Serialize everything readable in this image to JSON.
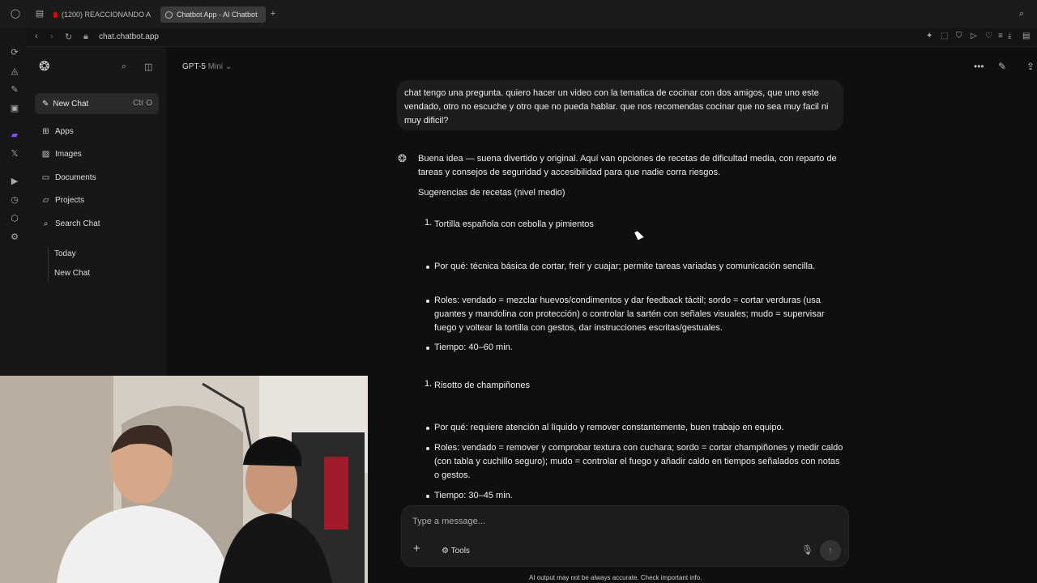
{
  "browser": {
    "tabs": [
      {
        "label": "(1200) REACCIONANDO A"
      },
      {
        "label": "Chatbot App - AI Chatbot"
      }
    ],
    "url": "chat.chatbot.app"
  },
  "sidebar": {
    "new_chat": "New Chat",
    "new_chat_shortcut": "Ctr O",
    "items": [
      {
        "label": "Apps",
        "icon": "grid-icon"
      },
      {
        "label": "Images",
        "icon": "image-icon"
      },
      {
        "label": "Documents",
        "icon": "document-icon"
      },
      {
        "label": "Projects",
        "icon": "folder-icon"
      },
      {
        "label": "Search Chat",
        "icon": "search-icon"
      }
    ],
    "history_section": "Today",
    "history_items": [
      "New Chat"
    ]
  },
  "header": {
    "model": "GPT-5",
    "model_variant": "Mini"
  },
  "conversation": {
    "user_message": "chat tengo una pregunta. quiero hacer un video con la tematica de cocinar con dos amigos, que uno este vendado, otro no escuche y otro que no pueda hablar. que nos recomendas cocinar que no sea muy facil ni muy dificil?",
    "assistant": {
      "intro": "Buena idea — suena divertido y original. Aquí van opciones de recetas de dificultad media, con reparto de tareas y consejos de seguridad y accesibilidad para que nadie corra riesgos.",
      "section_title": "Sugerencias de recetas (nivel medio)",
      "recipes": [
        {
          "number": "1.",
          "title": "Tortilla española con cebolla y pimientos",
          "bullets": [
            "Por qué: técnica básica de cortar, freír y cuajar; permite tareas variadas y comunicación sencilla.",
            "Roles: vendado = mezclar huevos/condimentos y dar feedback táctil; sordo = cortar verduras (usa guantes y mandolina con protección) o controlar la sartén con señales visuales; mudo = supervisar fuego y voltear la tortilla con gestos, dar instrucciones escritas/gestuales.",
            "Tiempo: 40–60 min."
          ]
        },
        {
          "number": "1.",
          "title": "Risotto de champiñones",
          "bullets": [
            "Por qué: requiere atención al líquido y remover constantemente, buen trabajo en equipo.",
            "Roles: vendado = remover y comprobar textura con cuchara; sordo = cortar champiñones y medir caldo (con tabla y cuchillo seguro); mudo = controlar el fuego y añadir caldo en tiempos señalados con notas o gestos.",
            "Tiempo: 30–45 min."
          ]
        }
      ]
    }
  },
  "composer": {
    "placeholder": "Type a message...",
    "tools_label": "Tools",
    "disclaimer": "AI output may not be always accurate. Check important info."
  }
}
